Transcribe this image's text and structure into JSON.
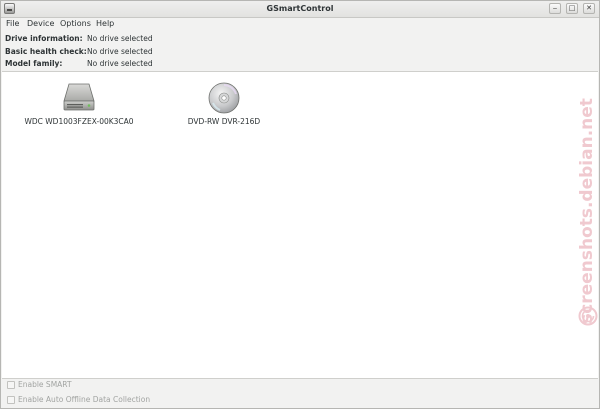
{
  "window": {
    "title": "GSmartControl",
    "minimize_glyph": "‒",
    "maximize_glyph": "□",
    "close_glyph": "✕"
  },
  "menu": {
    "items": [
      "File",
      "Device",
      "Options",
      "Help"
    ]
  },
  "info": {
    "drive_information_label": "Drive information:",
    "drive_information_value": "No drive selected",
    "basic_health_label": "Basic health check:",
    "basic_health_value": "No drive selected",
    "model_family_label": "Model family:",
    "model_family_value": "No drive selected"
  },
  "drives": [
    {
      "name": "WDC WD1003FZEX-00K3CA0",
      "icon": "hard-disk-icon"
    },
    {
      "name": "DVD-RW DVR-216D",
      "icon": "optical-disc-icon"
    }
  ],
  "options": {
    "enable_smart_label": "Enable SMART",
    "enable_smart_checked": false,
    "enable_offline_label": "Enable Auto Offline Data Collection",
    "enable_offline_checked": false
  },
  "watermark": {
    "text": "screenshots.debian.net"
  },
  "colors": {
    "watermark": "#f0c9cf",
    "disabled_text": "#a2a4a2"
  }
}
